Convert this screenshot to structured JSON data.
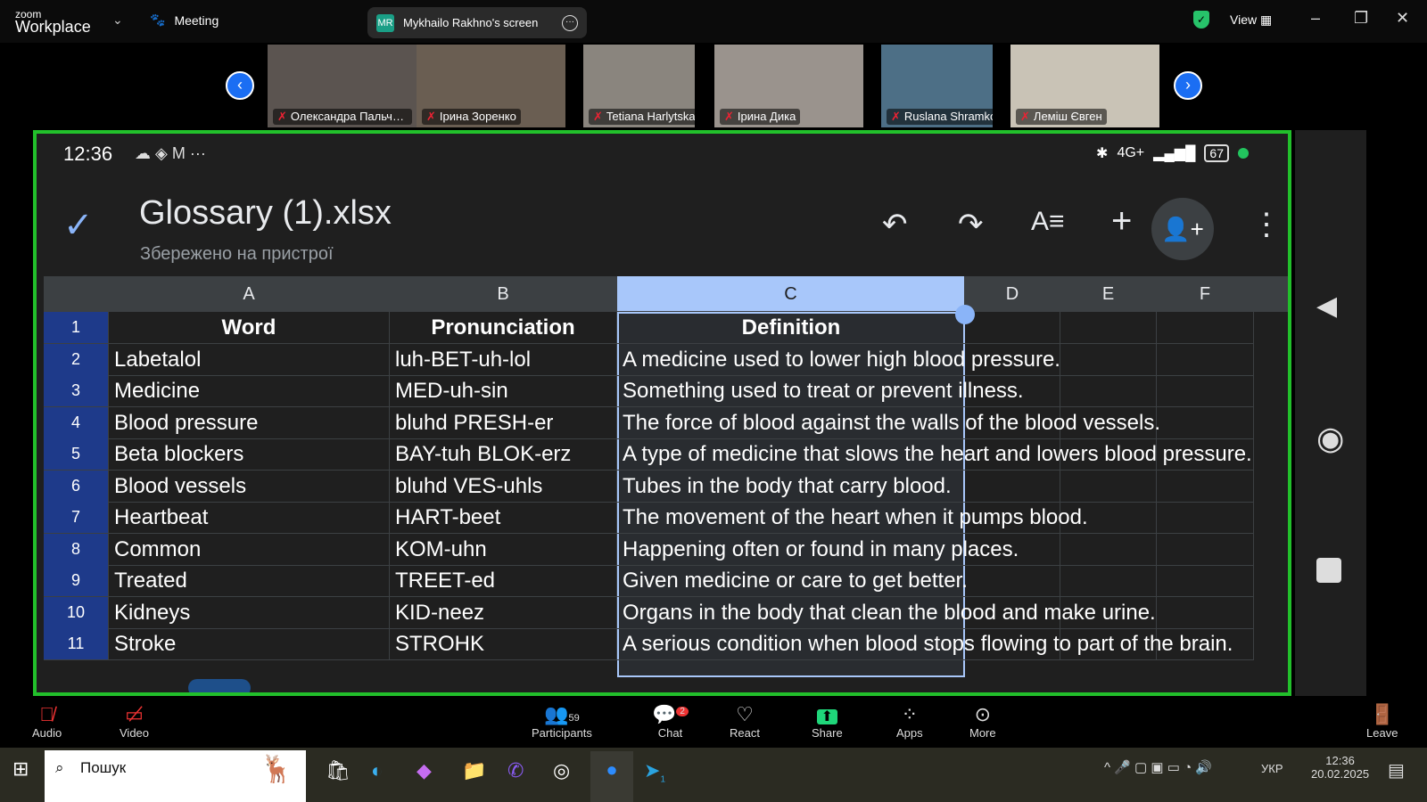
{
  "app": {
    "logo_small": "zoom",
    "logo_big": "Workplace",
    "meeting_label": "Meeting",
    "share_initials": "MR",
    "share_label": "Mykhailo Rakhno's screen",
    "view_label": "View"
  },
  "participants": [
    {
      "name": "Олександра Пальчик..."
    },
    {
      "name": "Ірина Зоренко"
    },
    {
      "name": "Tetiana Harlytska"
    },
    {
      "name": "Ірина Дика"
    },
    {
      "name": "Ruslana Shramko"
    },
    {
      "name": "Леміш Євген"
    }
  ],
  "phone": {
    "time": "12:36",
    "network": "4G+",
    "battery": "67",
    "file_title": "Glossary (1).xlsx",
    "file_subtitle": "Збережено на пристрої"
  },
  "sheet": {
    "columns": [
      "A",
      "B",
      "C",
      "D",
      "E",
      "F"
    ],
    "selected_column": "C",
    "rows": [
      {
        "n": "1",
        "a": "Word",
        "b": "Pronunciation",
        "c": "Definition"
      },
      {
        "n": "2",
        "a": "Labetalol",
        "b": "luh-BET-uh-lol",
        "c": "A medicine used to lower high blood pressure."
      },
      {
        "n": "3",
        "a": "Medicine",
        "b": "MED-uh-sin",
        "c": "Something used to treat or prevent illness."
      },
      {
        "n": "4",
        "a": "Blood pressure",
        "b": "bluhd PRESH-er",
        "c": "The force of blood against the walls of the blood vessels."
      },
      {
        "n": "5",
        "a": "Beta blockers",
        "b": "BAY-tuh BLOK-erz",
        "c": "A type of medicine that slows the heart and lowers blood pressure."
      },
      {
        "n": "6",
        "a": "Blood vessels",
        "b": "bluhd VES-uhls",
        "c": "Tubes in the body that carry blood."
      },
      {
        "n": "7",
        "a": "Heartbeat",
        "b": "HART-beet",
        "c": "The movement of the heart when it pumps blood."
      },
      {
        "n": "8",
        "a": "Common",
        "b": "KOM-uhn",
        "c": "Happening often or found in many places."
      },
      {
        "n": "9",
        "a": "Treated",
        "b": "TREET-ed",
        "c": "Given medicine or care to get better."
      },
      {
        "n": "10",
        "a": "Kidneys",
        "b": "KID-neez",
        "c": "Organs in the body that clean the blood and make urine."
      },
      {
        "n": "11",
        "a": "Stroke",
        "b": "STROHK",
        "c": "A serious condition when blood stops flowing to part of the brain."
      }
    ]
  },
  "toolbar": {
    "audio": "Audio",
    "video": "Video",
    "participants": "Participants",
    "participants_count": "59",
    "chat": "Chat",
    "chat_badge": "2",
    "react": "React",
    "share": "Share",
    "apps": "Apps",
    "more": "More",
    "leave": "Leave"
  },
  "taskbar": {
    "search_placeholder": "Пошук",
    "lang": "УКР",
    "time": "12:36",
    "date": "20.02.2025",
    "telegram_badge": "1"
  },
  "colors": {
    "share_border": "#22c02b",
    "selection": "#a8c7fa",
    "share_button": "#1fd67a",
    "zoom_blue": "#1b6ef3"
  }
}
